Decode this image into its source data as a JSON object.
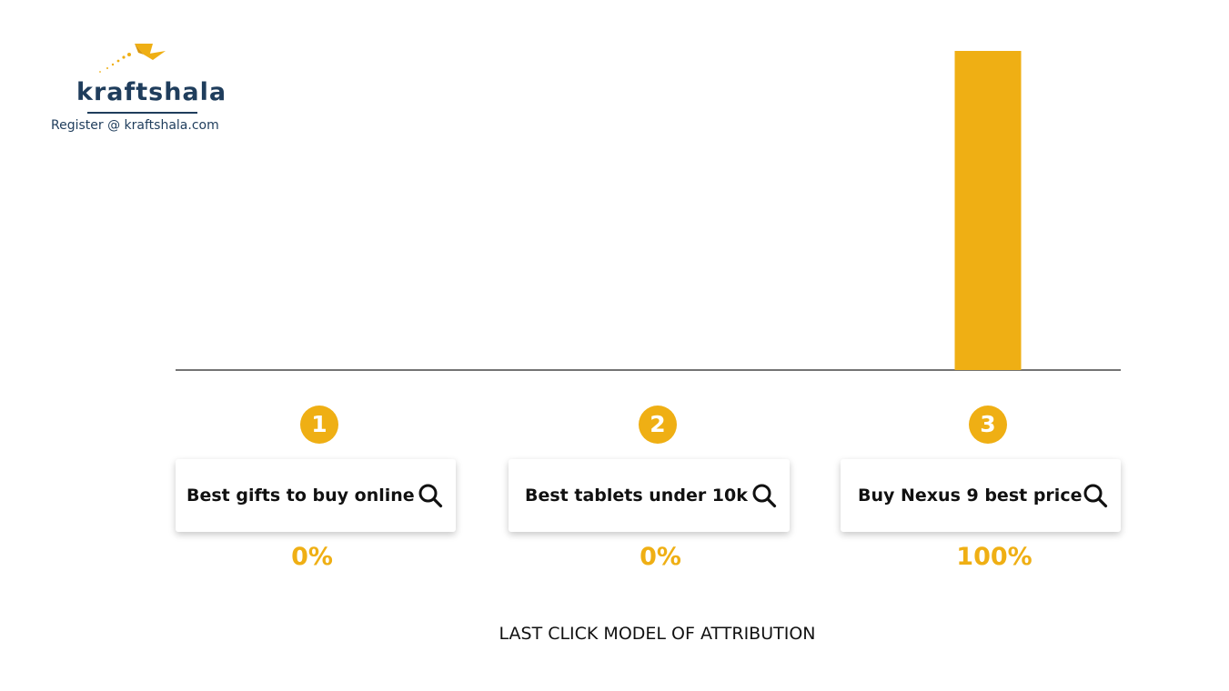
{
  "brand": {
    "name": "kraftshala",
    "tagline": "Register @ kraftshala.com",
    "primary_color": "#1f3d5c",
    "accent_color": "#efaf14"
  },
  "chart_data": {
    "type": "bar",
    "categories": [
      "Best gifts to buy online",
      "Best tablets under 10k",
      "Buy Nexus 9 best price"
    ],
    "values": [
      0,
      0,
      100
    ],
    "unit": "%",
    "ylim": [
      0,
      100
    ],
    "grid": false,
    "bar_color": "#efaf14",
    "title": "LAST CLICK MODEL OF ATTRIBUTION"
  },
  "steps": [
    {
      "number": "1",
      "query": "Best gifts to buy online",
      "share": "0%",
      "icon": "search-icon"
    },
    {
      "number": "2",
      "query": "Best tablets under 10k",
      "share": "0%",
      "icon": "search-icon"
    },
    {
      "number": "3",
      "query": "Buy Nexus 9 best price",
      "share": "100%",
      "icon": "search-icon"
    }
  ]
}
